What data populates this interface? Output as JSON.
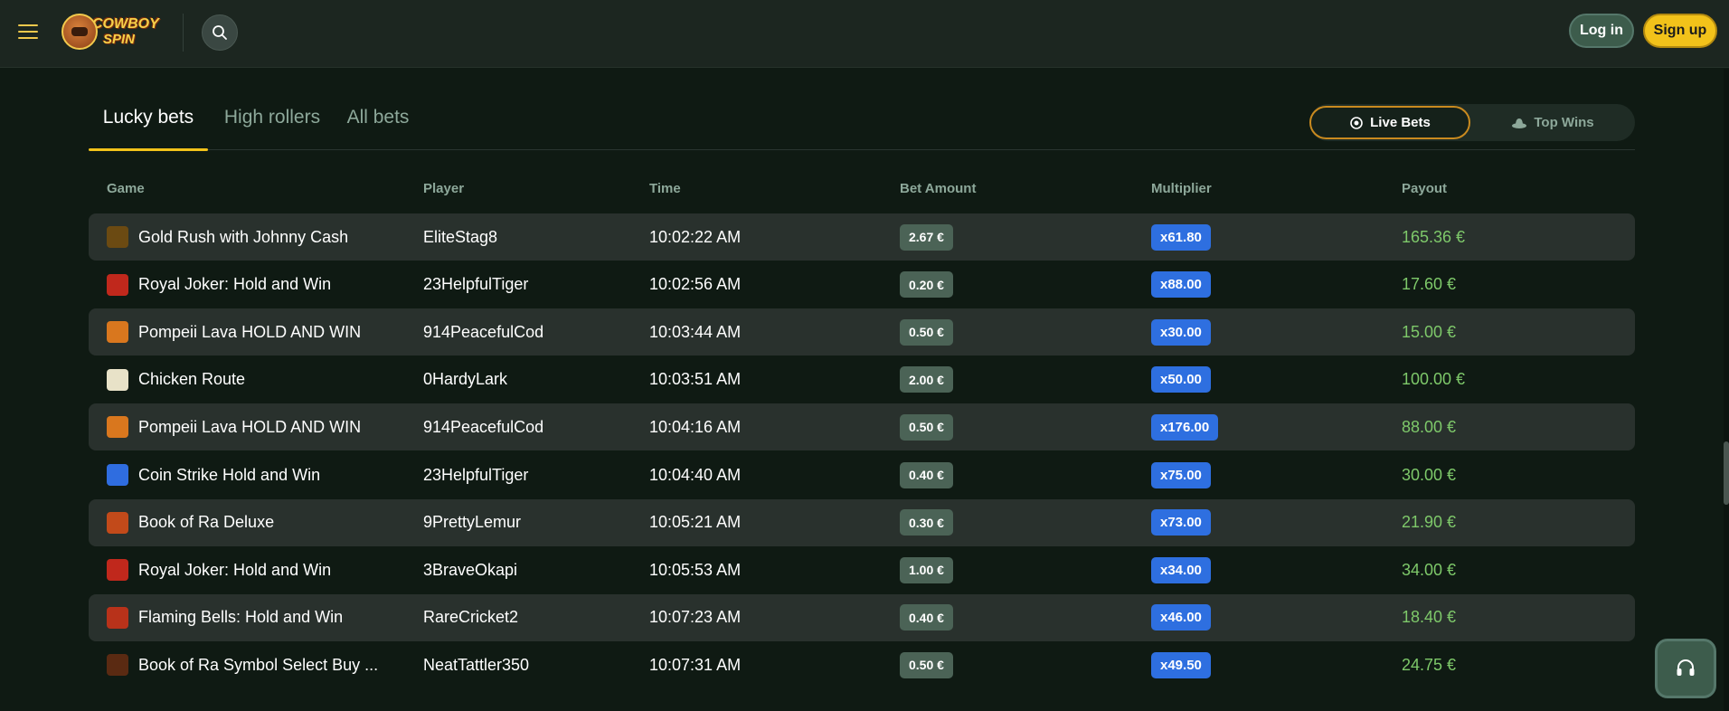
{
  "header": {
    "logo_line1": "COWBOY",
    "logo_line2": "SPIN",
    "login_label": "Log in",
    "signup_label": "Sign up"
  },
  "tabs": [
    {
      "label": "Lucky bets",
      "active": true
    },
    {
      "label": "High rollers",
      "active": false
    },
    {
      "label": "All bets",
      "active": false
    }
  ],
  "toggle": {
    "live_label": "Live Bets",
    "top_label": "Top Wins"
  },
  "columns": {
    "game": "Game",
    "player": "Player",
    "time": "Time",
    "bet": "Bet Amount",
    "multiplier": "Multiplier",
    "payout": "Payout"
  },
  "rows": [
    {
      "game": "Gold Rush with Johnny Cash",
      "player": "EliteStag8",
      "time": "10:02:22 AM",
      "bet": "2.67 €",
      "multiplier": "x61.80",
      "payout": "165.36 €",
      "icon": "gold-rush-icon",
      "color": "#6b4a12"
    },
    {
      "game": "Royal Joker: Hold and Win",
      "player": "23HelpfulTiger",
      "time": "10:02:56 AM",
      "bet": "0.20 €",
      "multiplier": "x88.00",
      "payout": "17.60 €",
      "icon": "royal-joker-icon",
      "color": "#c0281c"
    },
    {
      "game": "Pompeii Lava HOLD AND WIN",
      "player": "914PeacefulCod",
      "time": "10:03:44 AM",
      "bet": "0.50 €",
      "multiplier": "x30.00",
      "payout": "15.00 €",
      "icon": "pompeii-lava-icon",
      "color": "#d9771e"
    },
    {
      "game": "Chicken Route",
      "player": "0HardyLark",
      "time": "10:03:51 AM",
      "bet": "2.00 €",
      "multiplier": "x50.00",
      "payout": "100.00 €",
      "icon": "chicken-route-icon",
      "color": "#e8e2c8"
    },
    {
      "game": "Pompeii Lava HOLD AND WIN",
      "player": "914PeacefulCod",
      "time": "10:04:16 AM",
      "bet": "0.50 €",
      "multiplier": "x176.00",
      "payout": "88.00 €",
      "icon": "pompeii-lava-icon",
      "color": "#d9771e"
    },
    {
      "game": "Coin Strike Hold and Win",
      "player": "23HelpfulTiger",
      "time": "10:04:40 AM",
      "bet": "0.40 €",
      "multiplier": "x75.00",
      "payout": "30.00 €",
      "icon": "coin-strike-icon",
      "color": "#2f6de0"
    },
    {
      "game": "Book of Ra Deluxe",
      "player": "9PrettyLemur",
      "time": "10:05:21 AM",
      "bet": "0.30 €",
      "multiplier": "x73.00",
      "payout": "21.90 €",
      "icon": "book-of-ra-icon",
      "color": "#c24a1a"
    },
    {
      "game": "Royal Joker: Hold and Win",
      "player": "3BraveOkapi",
      "time": "10:05:53 AM",
      "bet": "1.00 €",
      "multiplier": "x34.00",
      "payout": "34.00 €",
      "icon": "royal-joker-icon",
      "color": "#c0281c"
    },
    {
      "game": "Flaming Bells: Hold and Win",
      "player": "RareCricket2",
      "time": "10:07:23 AM",
      "bet": "0.40 €",
      "multiplier": "x46.00",
      "payout": "18.40 €",
      "icon": "flaming-bells-icon",
      "color": "#b8321a"
    },
    {
      "game": "Book of Ra Symbol Select Buy ...",
      "player": "NeatTattler350",
      "time": "10:07:31 AM",
      "bet": "0.50 €",
      "multiplier": "x49.50",
      "payout": "24.75 €",
      "icon": "book-of-ra-select-icon",
      "color": "#5a2a12"
    }
  ],
  "colors": {
    "accent": "#f2c21a",
    "payout": "#7ec96a",
    "multiplier": "#2e6fe0"
  }
}
